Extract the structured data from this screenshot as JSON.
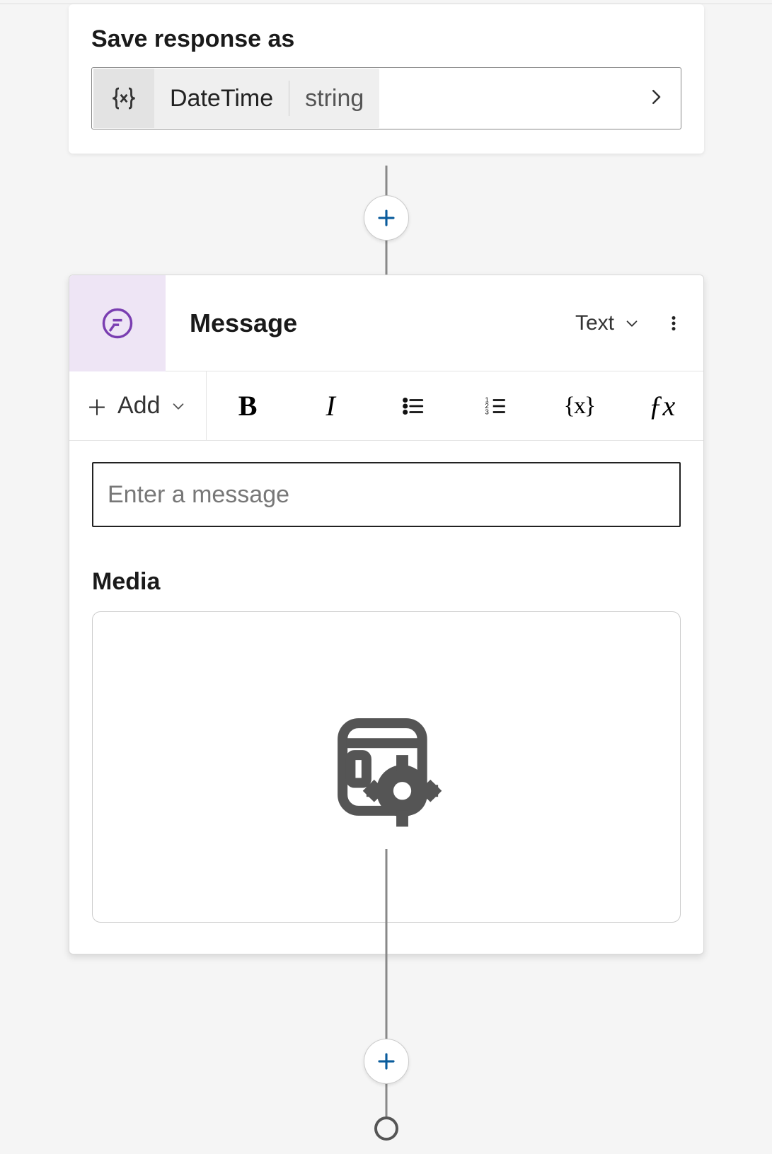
{
  "card1": {
    "title": "Save response as",
    "variable": {
      "icon": "variable-icon",
      "name": "DateTime",
      "type": "string"
    }
  },
  "card2": {
    "title": "Message",
    "typeDropdown": {
      "selected": "Text"
    },
    "toolbar": {
      "addLabel": "Add"
    },
    "input": {
      "placeholder": "Enter a message"
    },
    "mediaTitle": "Media"
  }
}
